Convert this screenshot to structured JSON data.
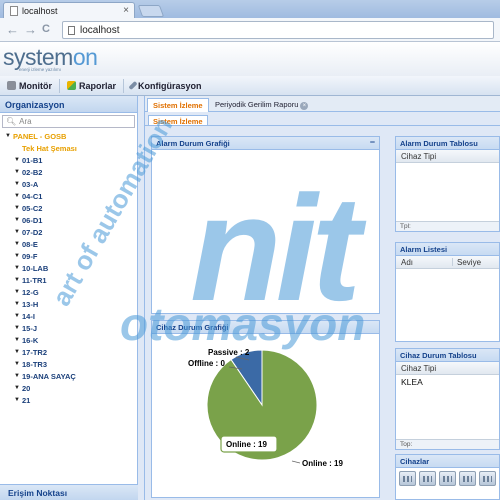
{
  "browser": {
    "tab_title": "localhost",
    "tab_close": "×",
    "url": "localhost",
    "back_glyph": "←",
    "forward_glyph": "→",
    "reload_glyph": "C"
  },
  "app": {
    "logo_main": "system",
    "logo_accent": "on",
    "logo_sub": "enerji izleme yazılımı"
  },
  "menu": [
    {
      "label": "Monitör",
      "icon": "monitor-icon",
      "color": "#8a8f99"
    },
    {
      "label": "Raporlar",
      "icon": "reports-icon",
      "color": "#e8b400"
    },
    {
      "label": "Konfigürasyon",
      "icon": "wrench-icon",
      "color": "#7b8da5"
    }
  ],
  "sidebar": {
    "title": "Organizasyon",
    "search_placeholder": "Ara",
    "root": "PANEL - GOSB",
    "items": [
      "Tek Hat Şeması",
      "01-B1",
      "02-B2",
      "03-A",
      "04-C1",
      "05-C2",
      "06-D1",
      "07-D2",
      "08-E",
      "09-F",
      "10-LAB",
      "11-TR1",
      "12-G",
      "13-H",
      "14-I",
      "15-J",
      "16-K",
      "17-TR2",
      "18-TR3",
      "19-ANA SAYAÇ",
      "20",
      "21"
    ],
    "footer": "Erişim Noktası"
  },
  "content": {
    "tabs": [
      {
        "label": "Sistem İzleme"
      },
      {
        "label": "Periyodik Gerilim Raporu"
      }
    ],
    "subtab": "Sistem İzleme"
  },
  "panels": {
    "alarm_chart": {
      "title": "Alarm Durum Grafiği",
      "min": "−"
    },
    "device_chart": {
      "title": "Cihaz Durum Grafiği"
    },
    "alarm_table": {
      "title": "Alarm Durum Tablosu",
      "column": "Cihaz Tipi",
      "footer": "Tpl:"
    },
    "alarm_list": {
      "title": "Alarm Listesi",
      "columns": [
        "Adı",
        "Seviye"
      ]
    },
    "device_table": {
      "title": "Cihaz Durum Tablosu",
      "column": "Cihaz Tipi",
      "row": "KLEA",
      "footer": "Top:"
    },
    "devices": {
      "title": "Cihazlar",
      "count": 5
    }
  },
  "chart_data": {
    "type": "pie",
    "slices": [
      {
        "label": "Online",
        "value": 19,
        "color": "#7aa24a"
      },
      {
        "label": "Passive",
        "value": 2,
        "color": "#3b6aa6"
      },
      {
        "label": "Offline",
        "value": 0,
        "color": "#bccbe0"
      }
    ],
    "labels": {
      "passive": "Passive : 2",
      "offline": "Offline : 0",
      "online": "Online : 19",
      "tooltip": "Online : 19"
    }
  },
  "watermark": {
    "line1": "art of automation",
    "line2": "nit",
    "line3": "otomasyon",
    "color": "#4b9ad8"
  }
}
